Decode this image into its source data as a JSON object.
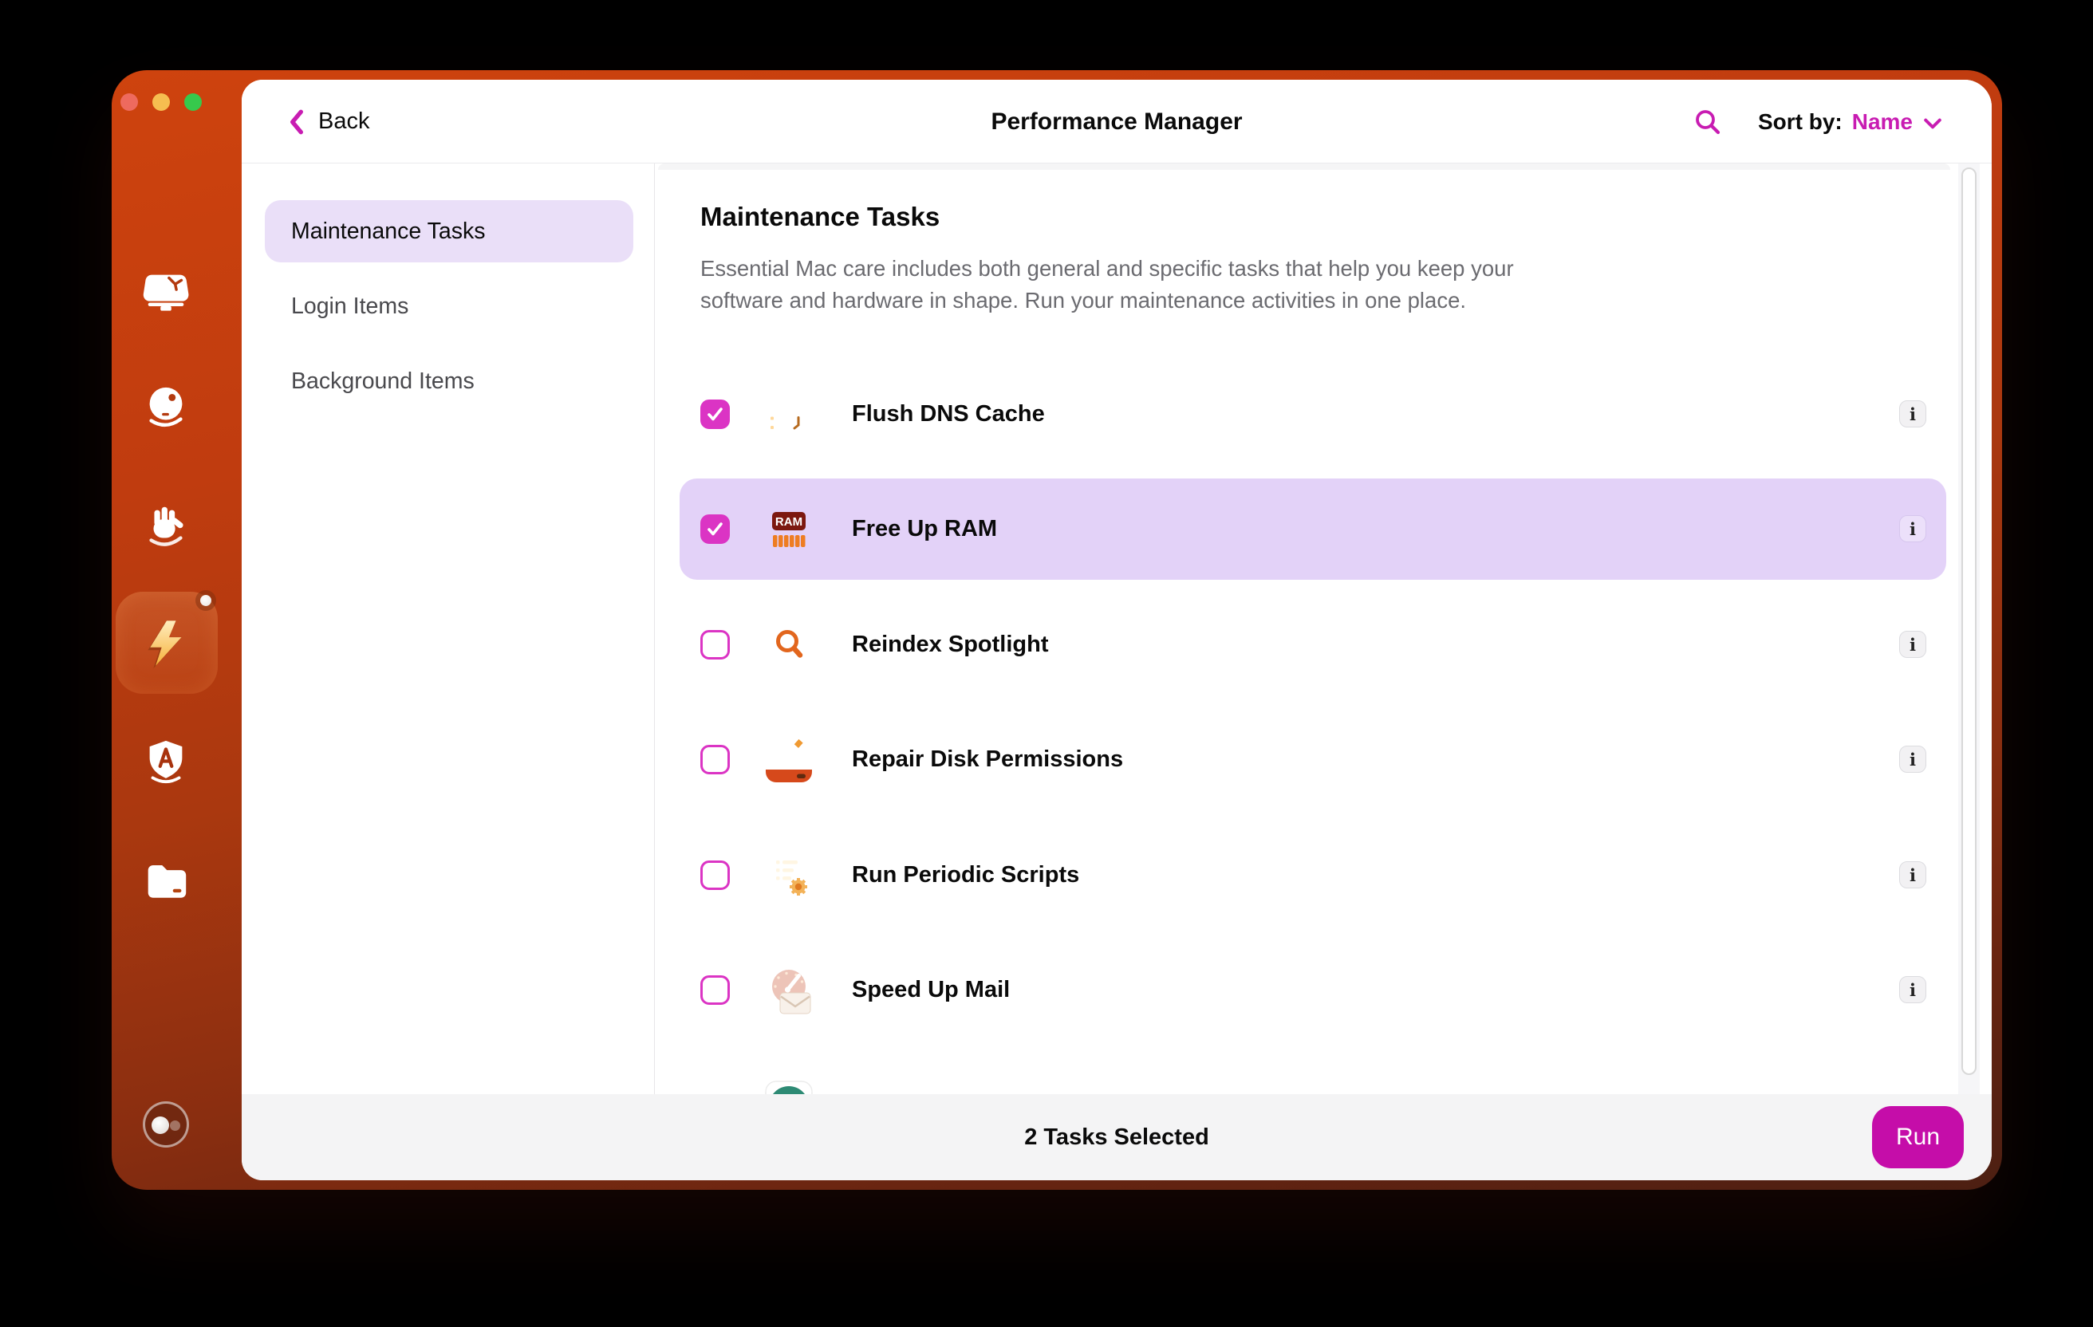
{
  "titlebar": {
    "back_label": "Back",
    "title": "Performance Manager",
    "sort_by_label": "Sort by:",
    "sort_value": "Name"
  },
  "rail": {
    "items": [
      {
        "name": "cleanup-monitor-icon",
        "selected": false
      },
      {
        "name": "smart-ball-icon",
        "selected": false
      },
      {
        "name": "protection-hand-icon",
        "selected": false
      },
      {
        "name": "performance-bolt-icon",
        "selected": true,
        "badge": true
      },
      {
        "name": "applications-shield-icon",
        "selected": false
      },
      {
        "name": "files-folder-icon",
        "selected": false
      },
      {
        "name": "assistant-toggle-icon",
        "selected": false
      }
    ]
  },
  "sidebar": {
    "items": [
      {
        "label": "Maintenance Tasks",
        "selected": true
      },
      {
        "label": "Login Items",
        "selected": false
      },
      {
        "label": "Background Items",
        "selected": false
      }
    ]
  },
  "content": {
    "heading": "Maintenance Tasks",
    "description": "Essential Mac care includes both general and specific tasks that help you keep your software and hardware in shape. Run your maintenance activities in one place.",
    "info_label": "i",
    "tasks": [
      {
        "label": "Flush DNS Cache",
        "icon": "dns",
        "checked": true,
        "highlighted": false,
        "partial": false
      },
      {
        "label": "Free Up RAM",
        "icon": "ram",
        "checked": true,
        "highlighted": true,
        "partial": false
      },
      {
        "label": "Reindex Spotlight",
        "icon": "spotlight",
        "checked": false,
        "highlighted": false,
        "partial": false
      },
      {
        "label": "Repair Disk Permissions",
        "icon": "disk",
        "checked": false,
        "highlighted": false,
        "partial": false
      },
      {
        "label": "Run Periodic Scripts",
        "icon": "scripts",
        "checked": false,
        "highlighted": false,
        "partial": false
      },
      {
        "label": "Speed Up Mail",
        "icon": "mail",
        "checked": false,
        "highlighted": false,
        "partial": false
      },
      {
        "label": "",
        "icon": "teal-partial",
        "checked": false,
        "highlighted": false,
        "partial": true
      }
    ]
  },
  "footer": {
    "status": "2 Tasks Selected",
    "run_label": "Run"
  },
  "colors": {
    "accent": "#c81cb2",
    "checkbox_checked": "#db34c4",
    "run_button": "#c50da9",
    "row_highlight": "#e3d2f8",
    "sidebar_pill": "#eadff8",
    "footer_bg": "#f4f4f5"
  }
}
